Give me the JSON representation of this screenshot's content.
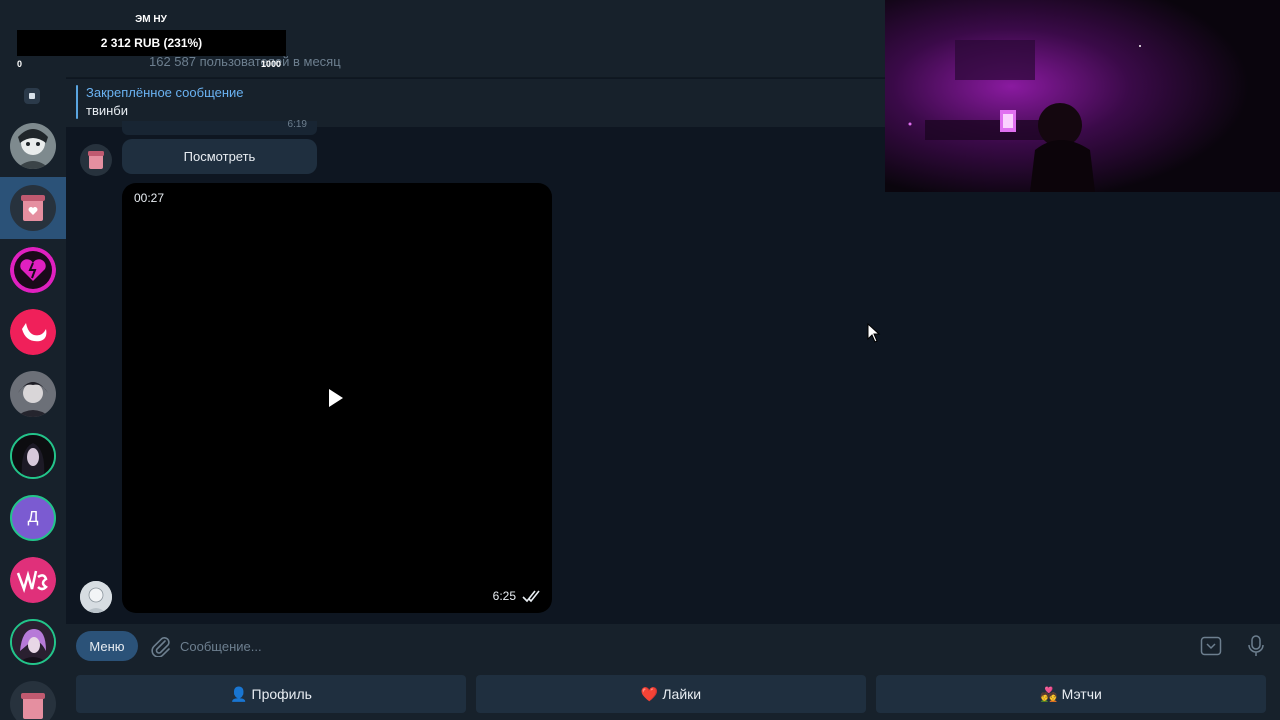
{
  "donation": {
    "name": "ЭМ НУ",
    "amount": "2 312 RUB (231%)",
    "min": "0",
    "max": "1000"
  },
  "header": {
    "subtitle": "162 587 пользователей в месяц"
  },
  "pinned": {
    "title": "Закреплённое сообщение",
    "text": "твинби"
  },
  "messages": {
    "peek_time": "6:19",
    "view_button": "Посмотреть",
    "video": {
      "duration": "00:27",
      "time": "6:25"
    }
  },
  "input": {
    "menu_label": "Меню",
    "placeholder": "Сообщение..."
  },
  "keyboard": {
    "buttons": [
      {
        "emoji": "👤",
        "label": "Профиль"
      },
      {
        "emoji": "❤️",
        "label": "Лайки"
      },
      {
        "emoji": "💑",
        "label": "Мэтчи"
      }
    ]
  },
  "colors": {
    "accent": "#2b5278",
    "link": "#6ab2f2",
    "background": "#0e1621",
    "panel": "#17212b"
  },
  "sidebar": {
    "avatars": [
      {
        "name": "avatar-chat-1"
      },
      {
        "name": "avatar-chat-2",
        "active": true
      },
      {
        "name": "avatar-chat-3"
      },
      {
        "name": "avatar-chat-4"
      },
      {
        "name": "avatar-chat-5"
      },
      {
        "name": "avatar-chat-6"
      },
      {
        "name": "avatar-chat-7",
        "letter": "Д"
      },
      {
        "name": "avatar-chat-8"
      },
      {
        "name": "avatar-chat-9"
      },
      {
        "name": "avatar-chat-10"
      }
    ]
  }
}
